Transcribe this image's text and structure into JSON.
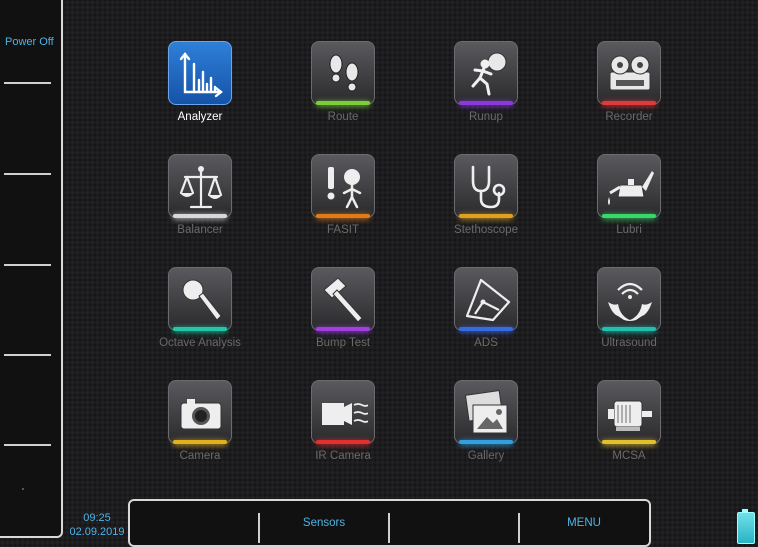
{
  "left_panel": {
    "top_key_label": "Power Off"
  },
  "apps": [
    {
      "label": "Analyzer",
      "icon": "spectrum-chart-icon",
      "active": true,
      "glow": "#2f7fd8"
    },
    {
      "label": "Route",
      "icon": "footprints-icon",
      "active": false,
      "glow": "#7ccf3a"
    },
    {
      "label": "Runup",
      "icon": "running-man-icon",
      "active": false,
      "glow": "#8a3ad8"
    },
    {
      "label": "Recorder",
      "icon": "tape-recorder-icon",
      "active": false,
      "glow": "#e03a3a"
    },
    {
      "label": "Balancer",
      "icon": "balance-scale-icon",
      "active": false,
      "glow": "#d8d8d8"
    },
    {
      "label": "FASIT",
      "icon": "expert-person-icon",
      "active": false,
      "glow": "#e07a1a"
    },
    {
      "label": "Stethoscope",
      "icon": "stethoscope-icon",
      "active": false,
      "glow": "#e0a020"
    },
    {
      "label": "Lubri",
      "icon": "oil-can-icon",
      "active": false,
      "glow": "#3ad86a"
    },
    {
      "label": "Octave Analysis",
      "icon": "microphone-icon",
      "active": false,
      "glow": "#20c8a8"
    },
    {
      "label": "Bump Test",
      "icon": "hammer-icon",
      "active": false,
      "glow": "#a040e0"
    },
    {
      "label": "ADS",
      "icon": "ads-diagram-icon",
      "active": false,
      "glow": "#3a6ae0"
    },
    {
      "label": "Ultrasound",
      "icon": "bat-ultrasound-icon",
      "active": false,
      "glow": "#20c0b0"
    },
    {
      "label": "Camera",
      "icon": "camera-icon",
      "active": false,
      "glow": "#e0b020"
    },
    {
      "label": "IR Camera",
      "icon": "ir-camera-icon",
      "active": false,
      "glow": "#e03030"
    },
    {
      "label": "Gallery",
      "icon": "gallery-icon",
      "active": false,
      "glow": "#30a0e0"
    },
    {
      "label": "MCSA",
      "icon": "motor-icon",
      "active": false,
      "glow": "#e0c030"
    }
  ],
  "status": {
    "time": "09:25",
    "date": "02.09.2019"
  },
  "bottom_bar": {
    "softkey_2": "Sensors",
    "softkey_4": "MENU"
  },
  "colors": {
    "accent": "#4fb3e8",
    "active_tile": "#2f7fd8",
    "inactive_label": "#6a6a6a"
  }
}
